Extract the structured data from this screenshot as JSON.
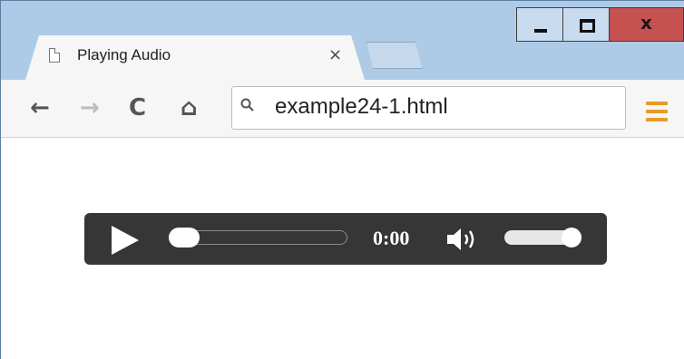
{
  "window": {
    "close_glyph": "x"
  },
  "tab": {
    "title": "Playing Audio",
    "close_glyph": "×"
  },
  "toolbar": {
    "back_glyph": "←",
    "forward_glyph": "→",
    "reload_glyph": "C",
    "home_glyph": "⌂",
    "address": "example24-1.html",
    "menu_color": "#e69b2a"
  },
  "player": {
    "time": "0:00",
    "progress": 0.0,
    "volume": 1.0
  },
  "icons": [
    "page-icon",
    "back-arrow-icon",
    "forward-arrow-icon",
    "reload-icon",
    "home-icon",
    "search-icon",
    "menu-icon",
    "play-icon",
    "volume-icon"
  ]
}
